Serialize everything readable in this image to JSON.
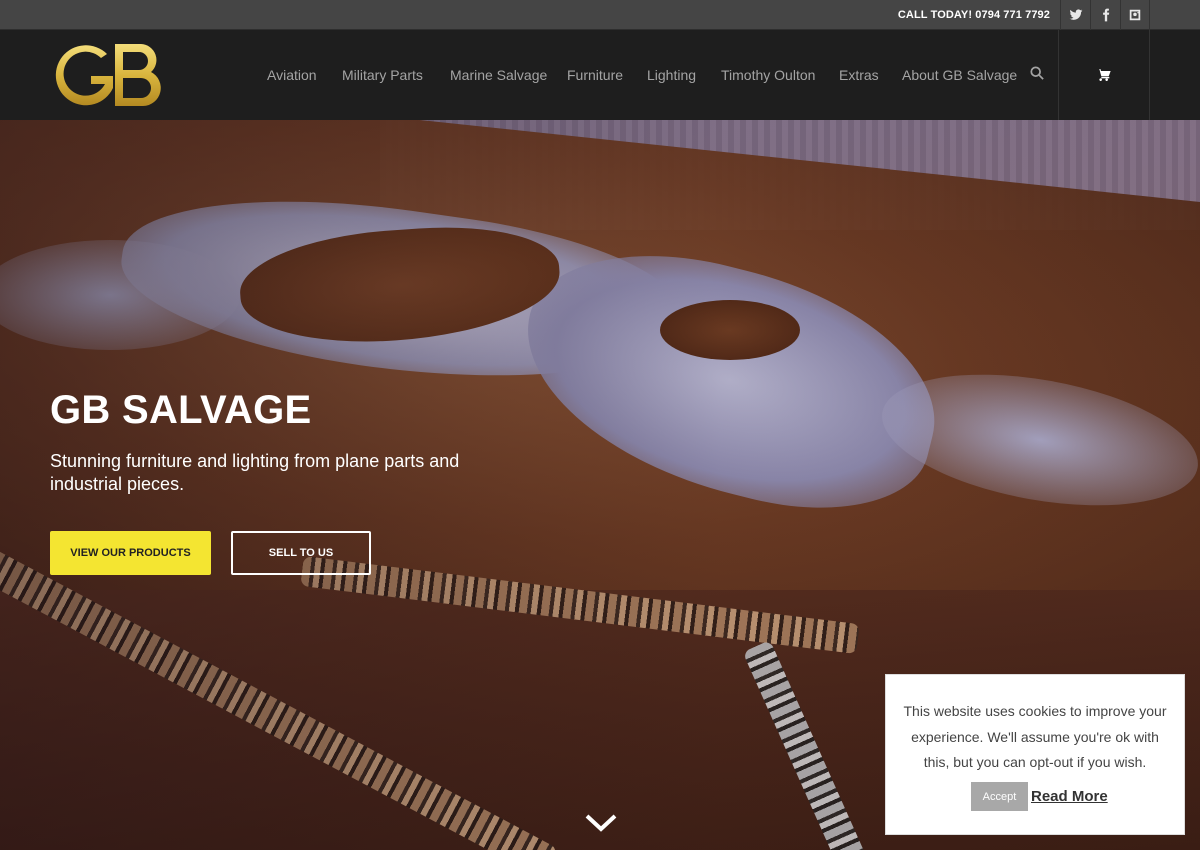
{
  "topbar": {
    "call_text": "CALL TODAY! 0794 771 7792",
    "social": [
      {
        "icon": "twitter-icon"
      },
      {
        "icon": "facebook-icon"
      },
      {
        "icon": "instagram-icon"
      }
    ]
  },
  "header": {
    "logo_text": "GB",
    "logo_color": "#e2c34a",
    "nav": [
      "Aviation",
      "Military Parts",
      "Marine Salvage",
      "Furniture",
      "Lighting",
      "Timothy Oulton",
      "Extras",
      "About GB Salvage"
    ],
    "search_icon": "search-icon",
    "cart_icon": "cart-icon"
  },
  "hero": {
    "title": "GB SALVAGE",
    "subtitle": "Stunning furniture and lighting from plane parts and industrial pieces.",
    "primary_button": "VIEW OUR PRODUCTS",
    "secondary_button": "SELL TO US",
    "primary_color": "#f4e531",
    "scroll_icon": "chevron-down-icon"
  },
  "cookie": {
    "message": "This website uses cookies to improve your experience. We'll assume you're ok with this, but you can opt-out if you wish.",
    "accept_label": "Accept",
    "read_more_label": "Read More"
  }
}
